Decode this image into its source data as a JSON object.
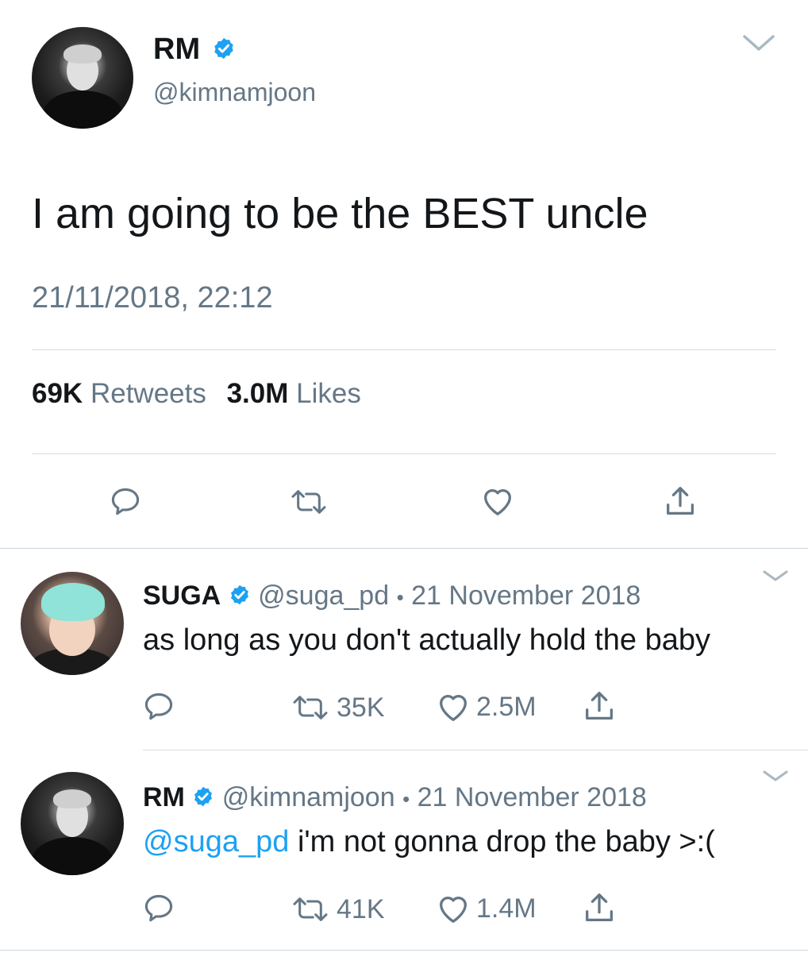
{
  "main_tweet": {
    "name": "RM",
    "handle": "@kimnamjoon",
    "text": "I am going to be the BEST uncle",
    "timestamp": "21/11/2018, 22:12",
    "retweets_count": "69K",
    "retweets_label": "Retweets",
    "likes_count": "3.0M",
    "likes_label": "Likes",
    "actions": [
      "reply-icon",
      "retweet-icon",
      "like-icon",
      "share-icon"
    ]
  },
  "replies": [
    {
      "name": "SUGA",
      "handle": "@suga_pd",
      "separator": "•",
      "date": "21 November 2018",
      "mention": "",
      "text": "as long as you don't actually hold the baby",
      "retweets": "35K",
      "likes": "2.5M"
    },
    {
      "name": "RM",
      "handle": "@kimnamjoon",
      "separator": "•",
      "date": "21 November 2018",
      "mention": "@suga_pd",
      "text": " i'm not gonna drop the baby >:(",
      "retweets": "41K",
      "likes": "1.4M"
    }
  ],
  "colors": {
    "verified": "#1da1f2",
    "link": "#1da1f2",
    "secondary_text": "#657786",
    "icon": "#657786"
  }
}
